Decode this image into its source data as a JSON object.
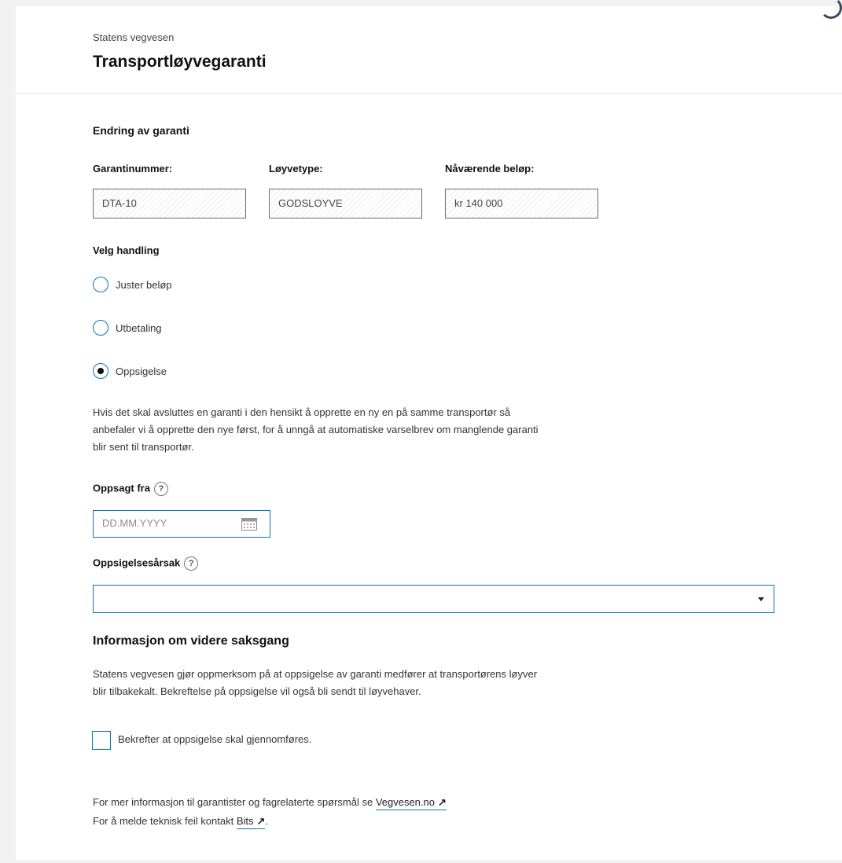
{
  "header": {
    "org": "Statens vegvesen",
    "title": "Transportløyvegaranti"
  },
  "section": {
    "heading": "Endring av garanti",
    "fields": [
      {
        "label": "Garantinummer:",
        "value": "DTA-10"
      },
      {
        "label": "Løyvetype:",
        "value": "GODSLOYVE"
      },
      {
        "label": "Nåværende beløp:",
        "value": "kr 140 000"
      }
    ]
  },
  "action": {
    "label": "Velg handling",
    "options": [
      {
        "label": "Juster beløp",
        "selected": false
      },
      {
        "label": "Utbetaling",
        "selected": false
      },
      {
        "label": "Oppsigelse",
        "selected": true
      }
    ]
  },
  "notice": {
    "lines": [
      "Hvis det skal avsluttes en garanti i den hensikt å opprette en ny en på samme transportør så",
      "anbefaler vi å opprette den nye først, for å unngå at automatiske varselbrev om manglende garanti",
      "blir sent til transportør."
    ]
  },
  "date_field": {
    "label": "Oppsagt fra",
    "help": "?",
    "placeholder": "DD.MM.YYYY",
    "icon": "calendar-icon"
  },
  "reason_field": {
    "label": "Oppsigelsesårsak",
    "help": "?",
    "value": "",
    "icon": "caret-down-icon"
  },
  "info": {
    "heading": "Informasjon om videre saksgang",
    "lines": [
      "Statens vegvesen gjør oppmerksom på at oppsigelse av garanti medfører at transportørens løyver",
      "blir tilbakekalt. Bekreftelse på oppsigelse vil også bli sendt til løyvehaver."
    ]
  },
  "confirm": {
    "label": "Bekrefter at oppsigelse skal gjennomføres.",
    "checked": false
  },
  "footer": {
    "line1_text": "For mer informasjon til garantister og fagrelaterte spørsmål se ",
    "line1_link": "Vegvesen.no",
    "line2_text": "For å melde teknisk feil kontakt ",
    "line2_link": "Bits",
    "line2_end": ".",
    "external_icon": "external-link-icon"
  },
  "colors": {
    "accent": "#0b77b5",
    "background": "#f2f2f2",
    "card": "#ffffff"
  }
}
